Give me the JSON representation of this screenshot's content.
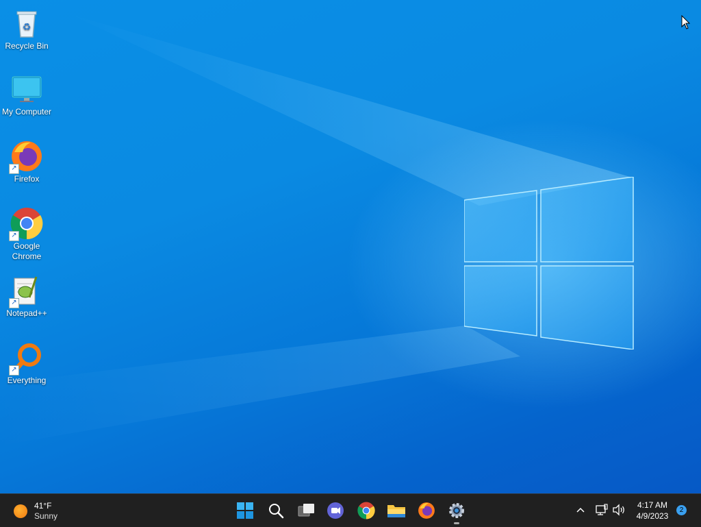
{
  "desktop": {
    "icons": [
      {
        "label": "Recycle Bin",
        "icon": "recycle-bin-icon"
      },
      {
        "label": "My Computer",
        "icon": "computer-monitor-icon"
      },
      {
        "label": "Firefox",
        "icon": "firefox-icon"
      },
      {
        "label": "Google Chrome",
        "icon": "chrome-icon"
      },
      {
        "label": "Notepad++",
        "icon": "notepad-plus-plus-icon"
      },
      {
        "label": "Everything",
        "icon": "everything-search-icon"
      }
    ]
  },
  "taskbar": {
    "weather": {
      "temp": "41°F",
      "condition": "Sunny"
    },
    "apps": [
      {
        "name": "start",
        "icon": "windows-start-icon"
      },
      {
        "name": "search",
        "icon": "search-icon"
      },
      {
        "name": "task-view",
        "icon": "task-view-icon"
      },
      {
        "name": "chat",
        "icon": "teams-chat-icon"
      },
      {
        "name": "chrome",
        "icon": "chrome-icon"
      },
      {
        "name": "file-explorer",
        "icon": "folder-icon"
      },
      {
        "name": "firefox",
        "icon": "firefox-icon"
      },
      {
        "name": "settings",
        "icon": "gear-icon",
        "active": true
      }
    ],
    "tray": {
      "chevron": "chevron-up-icon",
      "network": "network-icon",
      "volume": "speaker-icon",
      "time": "4:17 AM",
      "date": "4/9/2023",
      "notification_count": "2"
    }
  },
  "colors": {
    "taskbar": "#202020",
    "desktop_blue": "#0a8fe6",
    "accent": "#3aa0f0"
  }
}
